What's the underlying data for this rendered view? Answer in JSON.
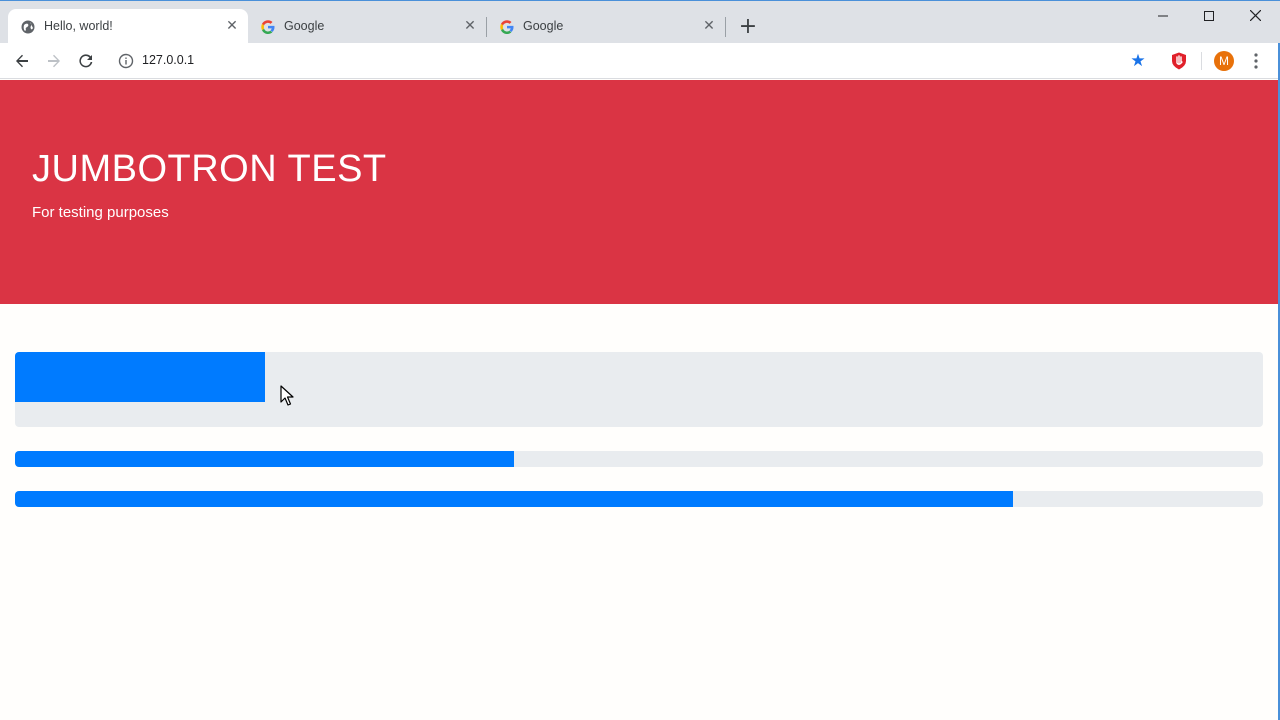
{
  "browser": {
    "tabs": [
      {
        "title": "Hello, world!",
        "icon": "globe-icon",
        "active": true
      },
      {
        "title": "Google",
        "icon": "google-icon",
        "active": false
      },
      {
        "title": "Google",
        "icon": "google-icon",
        "active": false
      }
    ],
    "new_tab_icon": "plus-icon",
    "window_controls": [
      "minimize-icon",
      "maximize-icon",
      "close-icon"
    ],
    "address": "127.0.0.1",
    "profile_initial": "M",
    "accent_color": "#1a73e8"
  },
  "page": {
    "jumbotron": {
      "title": "JUMBOTRON TEST",
      "subtitle": "For testing purposes",
      "background_color": "#da3444"
    },
    "progress_bars": [
      {
        "value_percent": 20,
        "color": "#007bff"
      },
      {
        "value_percent": 40,
        "color": "#007bff"
      },
      {
        "value_percent": 80,
        "color": "#007bff"
      }
    ]
  }
}
